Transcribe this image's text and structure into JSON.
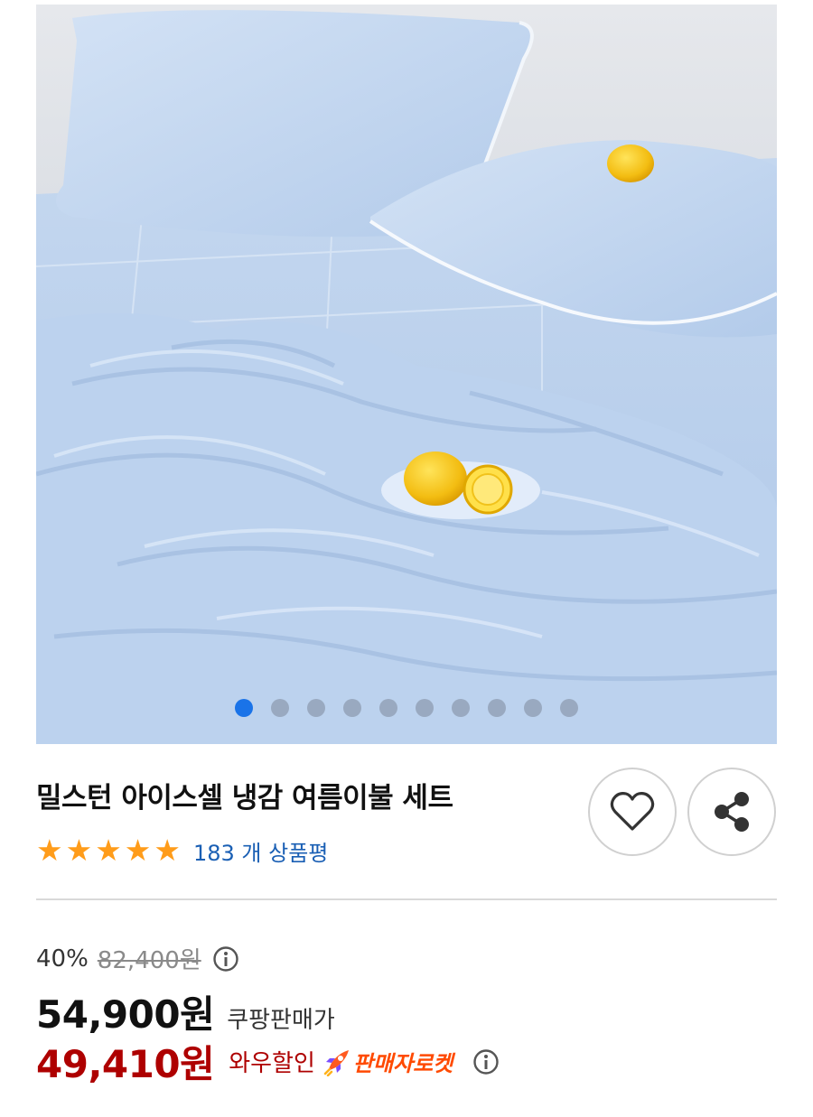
{
  "product": {
    "image_alt": "밀스턴 아이스셀 냉감 여름이불 세트",
    "image_count": 10,
    "active_image": 1,
    "title": "밀스턴 아이스셀 냉감 여름이불 세트",
    "rating": 5,
    "review_count": "183",
    "review_unit": "개 상품평"
  },
  "pricing": {
    "discount_percent": "40%",
    "original_price": "82,400원",
    "sale_price": "54,900원",
    "sale_label": "쿠팡판매가",
    "wow_price": "49,410원",
    "wow_label": "와우할인",
    "seller_badge": "판매자로켓"
  },
  "icons": {
    "favorite": "heart-icon",
    "share": "share-icon",
    "info": "info-icon",
    "star": "star-icon",
    "rocket": "rocket-icon"
  },
  "colors": {
    "accent_blue": "#1a73e8",
    "link_blue": "#1a5fb4",
    "star_orange": "#ff9c1a",
    "price_red": "#ae0000",
    "rocket_orange": "#ff4a00"
  }
}
